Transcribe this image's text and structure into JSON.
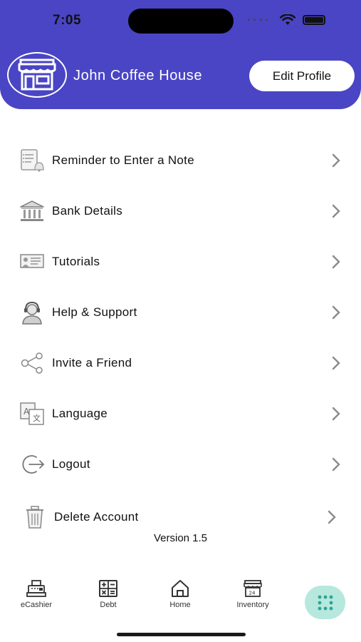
{
  "status_bar": {
    "time": "7:05"
  },
  "header": {
    "shop_name": "John Coffee House",
    "edit_profile_label": "Edit Profile"
  },
  "menu": {
    "items": [
      {
        "label": "Reminder to Enter a Note",
        "icon": "note-reminder-icon"
      },
      {
        "label": "Bank Details",
        "icon": "bank-icon"
      },
      {
        "label": "Tutorials",
        "icon": "tutorial-board-icon"
      },
      {
        "label": "Help & Support",
        "icon": "support-agent-icon"
      },
      {
        "label": "Invite a Friend",
        "icon": "share-icon"
      },
      {
        "label": "Language",
        "icon": "language-icon"
      },
      {
        "label": "Logout",
        "icon": "logout-icon"
      },
      {
        "label": "Delete Account",
        "icon": "trash-icon"
      }
    ]
  },
  "version": "Version 1.5",
  "tabbar": {
    "tabs": [
      {
        "label": "eCashier",
        "icon": "cash-register-icon"
      },
      {
        "label": "Debt",
        "icon": "calculator-icon"
      },
      {
        "label": "Home",
        "icon": "home-icon"
      },
      {
        "label": "Inventory",
        "icon": "store-24-icon"
      },
      {
        "label": "",
        "icon": "grid-dots-icon",
        "active": true
      }
    ]
  },
  "colors": {
    "header_bg": "#4a45c4",
    "active_tab_bg": "#b6e8dd",
    "active_tab_icon": "#2aa596"
  }
}
